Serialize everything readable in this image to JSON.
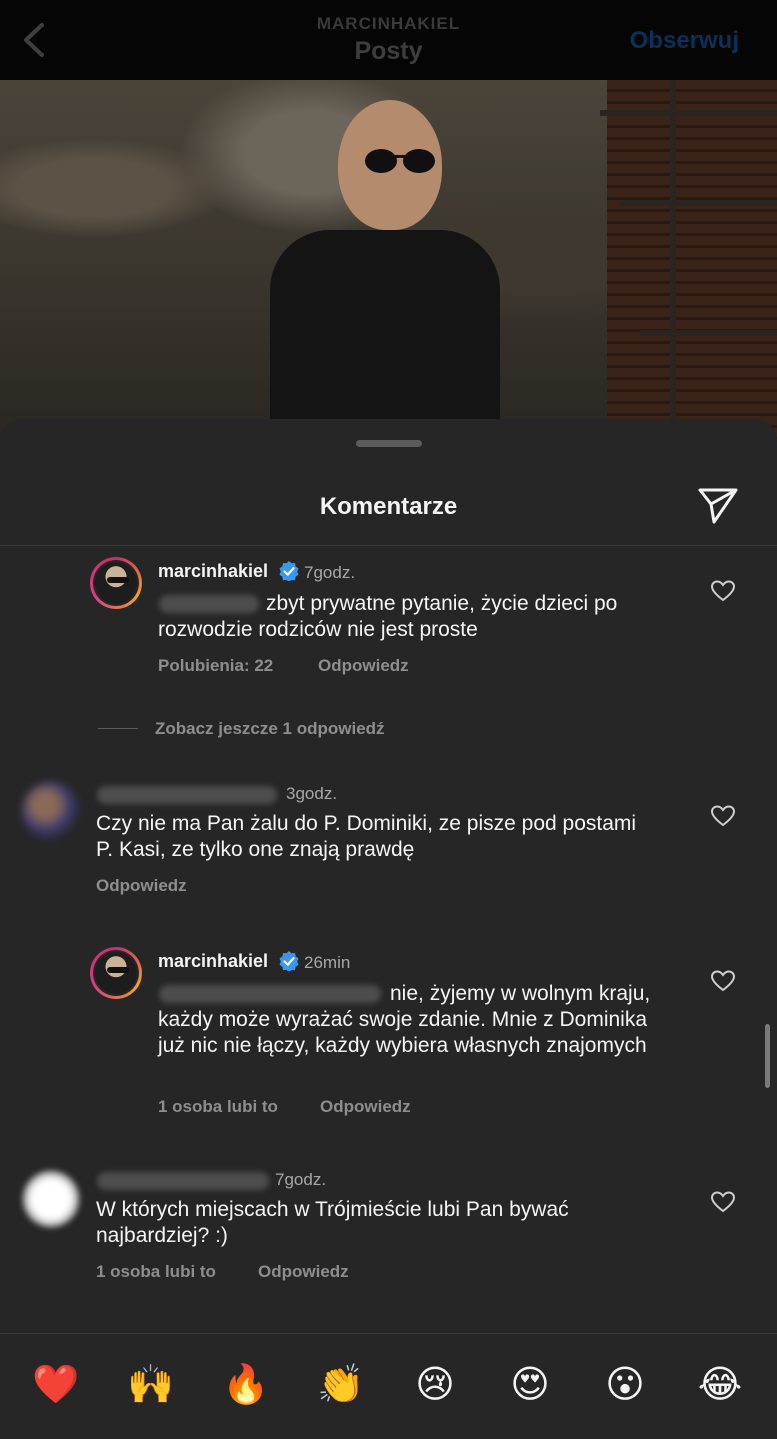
{
  "header": {
    "username": "MARCINHAKIEL",
    "title": "Posty",
    "follow_label": "Obserwuj"
  },
  "sheet": {
    "title": "Komentarze"
  },
  "comments": [
    {
      "username": "marcinhakiel",
      "verified": true,
      "time": "7godz.",
      "text": "zbyt prywatne pytanie, życie dzieci po rozwodzie rodziców nie jest proste",
      "likes": "Polubienia: 22",
      "reply": "Odpowiedz"
    },
    {
      "username": "",
      "verified": false,
      "time": "3godz.",
      "text": "Czy nie ma Pan żalu do P. Dominiki, ze pisze pod postami P. Kasi, ze tylko one znają prawdę",
      "likes": "",
      "reply": "Odpowiedz"
    },
    {
      "username": "marcinhakiel",
      "verified": true,
      "time": "26min",
      "text": "nie, żyjemy w wolnym kraju, każdy może wyrażać swoje zdanie. Mnie z Dominika już nic nie łączy, każdy wybiera własnych znajomych",
      "likes": "1 osoba lubi to",
      "reply": "Odpowiedz"
    },
    {
      "username": "",
      "verified": false,
      "time": "7godz.",
      "text": "W których miejscach w Trójmieście lubi Pan bywać najbardziej? :)",
      "likes": "1 osoba lubi to",
      "reply": "Odpowiedz"
    }
  ],
  "view_more_replies": "Zobacz jeszcze 1 odpowiedź",
  "emoji_bar": [
    "❤️",
    "🙌",
    "🔥",
    "👏",
    "😢",
    "😍",
    "😮",
    "😂"
  ],
  "colors": {
    "background": "#000000",
    "sheet": "#262626",
    "follow": "#0c3157",
    "muted": "#8e8e8e",
    "verified": "#3897f0"
  }
}
